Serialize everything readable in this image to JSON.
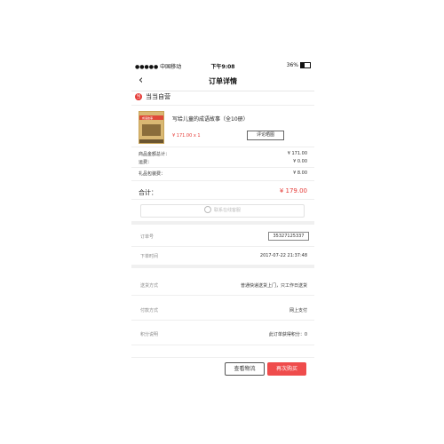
{
  "status_bar": {
    "carrier": "●●●●● 中国移动",
    "time": "下午9:08",
    "battery": "36%"
  },
  "nav": {
    "back_icon": "‹",
    "title": "订单详情"
  },
  "shop": {
    "logo_text": "当",
    "name": "当当自营"
  },
  "product": {
    "title": "写给儿童的成语故事（全10册）",
    "price_qty": "¥ 171.00 x 1",
    "review_label": "评论晒图",
    "book_cover_text": "成语故事"
  },
  "summary": {
    "rows": [
      {
        "label": "商品金额总计：",
        "value": "¥ 171.00"
      },
      {
        "label": "运费：",
        "value": "¥ 0.00"
      },
      {
        "label": "礼品包装费：",
        "value": "¥ 8.00"
      }
    ],
    "total_label": "合计：",
    "total_value": "¥ 179.00"
  },
  "customer_service": {
    "label": "联系在线客服"
  },
  "order": {
    "number_label": "订单号",
    "number_value": "35327125337",
    "time_label": "下单时间",
    "time_value": "2017-07-22 21:37:48"
  },
  "delivery": {
    "rows": [
      {
        "label": "送货方式",
        "value": "普通快递送货上门，只工作日送货"
      },
      {
        "label": "付款方式",
        "value": "网上支付"
      },
      {
        "label": "积分说明",
        "value": "此订单获得积分：0"
      }
    ]
  },
  "actions": {
    "logistics": "查看物流",
    "rebuy": "再次购买"
  },
  "colors": {
    "accent": "#ef4c4c",
    "price": "#e53935"
  }
}
